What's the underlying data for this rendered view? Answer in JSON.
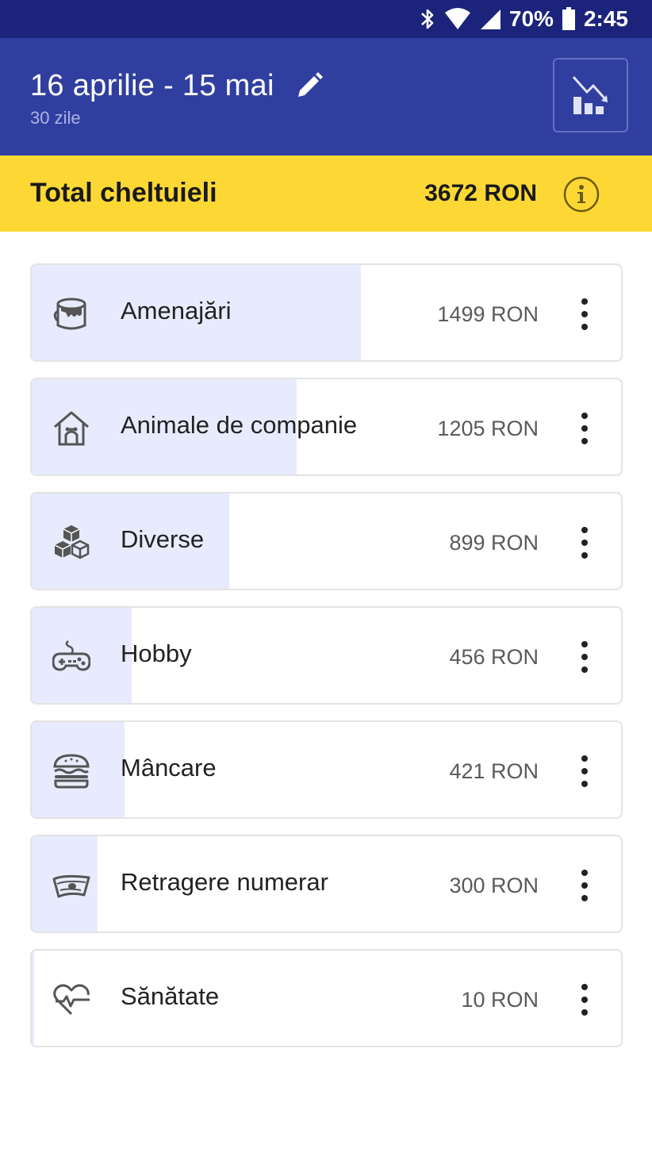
{
  "status_bar": {
    "battery": "70%",
    "time": "2:45"
  },
  "header": {
    "period": "16 aprilie - 15 mai",
    "days": "30 zile"
  },
  "total": {
    "label": "Total cheltuieli",
    "value": "3672 RON"
  },
  "categories": [
    {
      "name": "Amenajări",
      "amount": "1499 RON",
      "value": 1499,
      "icon": "paint-bucket-icon"
    },
    {
      "name": "Animale de companie",
      "amount": "1205 RON",
      "value": 1205,
      "icon": "pet-house-icon"
    },
    {
      "name": "Diverse",
      "amount": "899 RON",
      "value": 899,
      "icon": "cubes-icon"
    },
    {
      "name": "Hobby",
      "amount": "456 RON",
      "value": 456,
      "icon": "gamepad-icon"
    },
    {
      "name": "Mâncare",
      "amount": "421 RON",
      "value": 421,
      "icon": "burger-icon"
    },
    {
      "name": "Retragere numerar",
      "amount": "300 RON",
      "value": 300,
      "icon": "cash-icon"
    },
    {
      "name": "Sănătate",
      "amount": "10 RON",
      "value": 10,
      "icon": "heartbeat-icon"
    }
  ],
  "colors": {
    "header": "#303f9f",
    "status": "#1b237a",
    "accent": "#fdd835",
    "fill": "#e8ebfd"
  }
}
